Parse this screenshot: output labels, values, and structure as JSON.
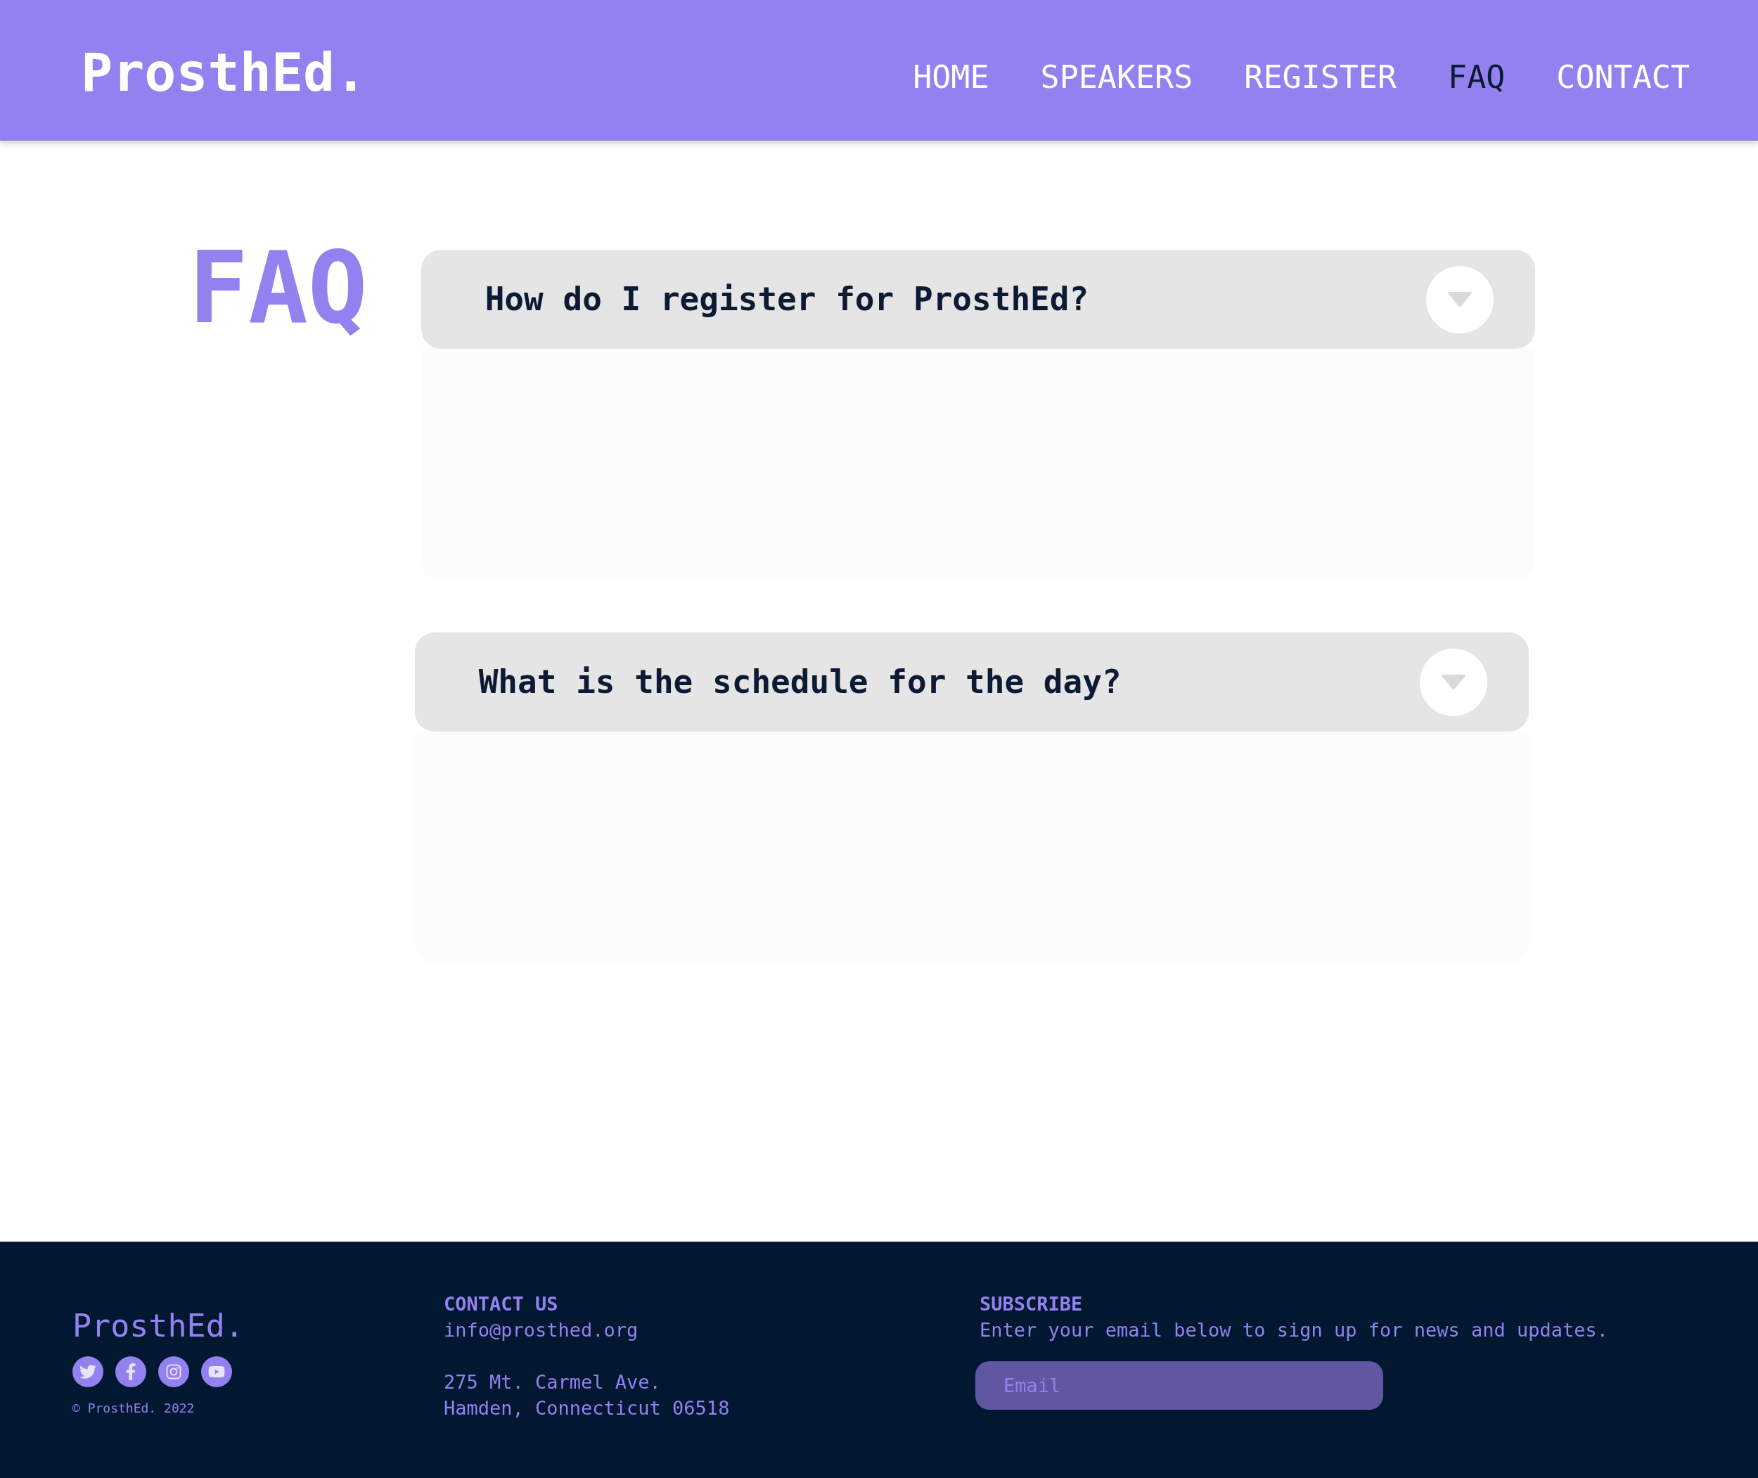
{
  "header": {
    "logo": "ProsthEd.",
    "nav": [
      {
        "label": "HOME",
        "selected": false
      },
      {
        "label": "SPEAKERS",
        "selected": false
      },
      {
        "label": "REGISTER",
        "selected": false
      },
      {
        "label": "FAQ",
        "selected": true
      },
      {
        "label": "CONTACT",
        "selected": false
      }
    ]
  },
  "faq": {
    "heading": "FAQ",
    "items": [
      {
        "question": "How do I register for ProsthEd?"
      },
      {
        "question": "What is the schedule for the day?"
      }
    ]
  },
  "footer": {
    "logo": "ProsthEd.",
    "copyright": "© ProsthEd. 2022",
    "contact": {
      "heading": "CONTACT US",
      "email": "info@prosthed.org",
      "address": [
        "275 Mt. Carmel Ave.",
        "Hamden, Connecticut 06518"
      ]
    },
    "subscribe": {
      "heading": "SUBSCRIBE",
      "text": "Enter your email below to sign up for news and updates.",
      "email_field": {
        "placeholder": "Email"
      }
    }
  }
}
